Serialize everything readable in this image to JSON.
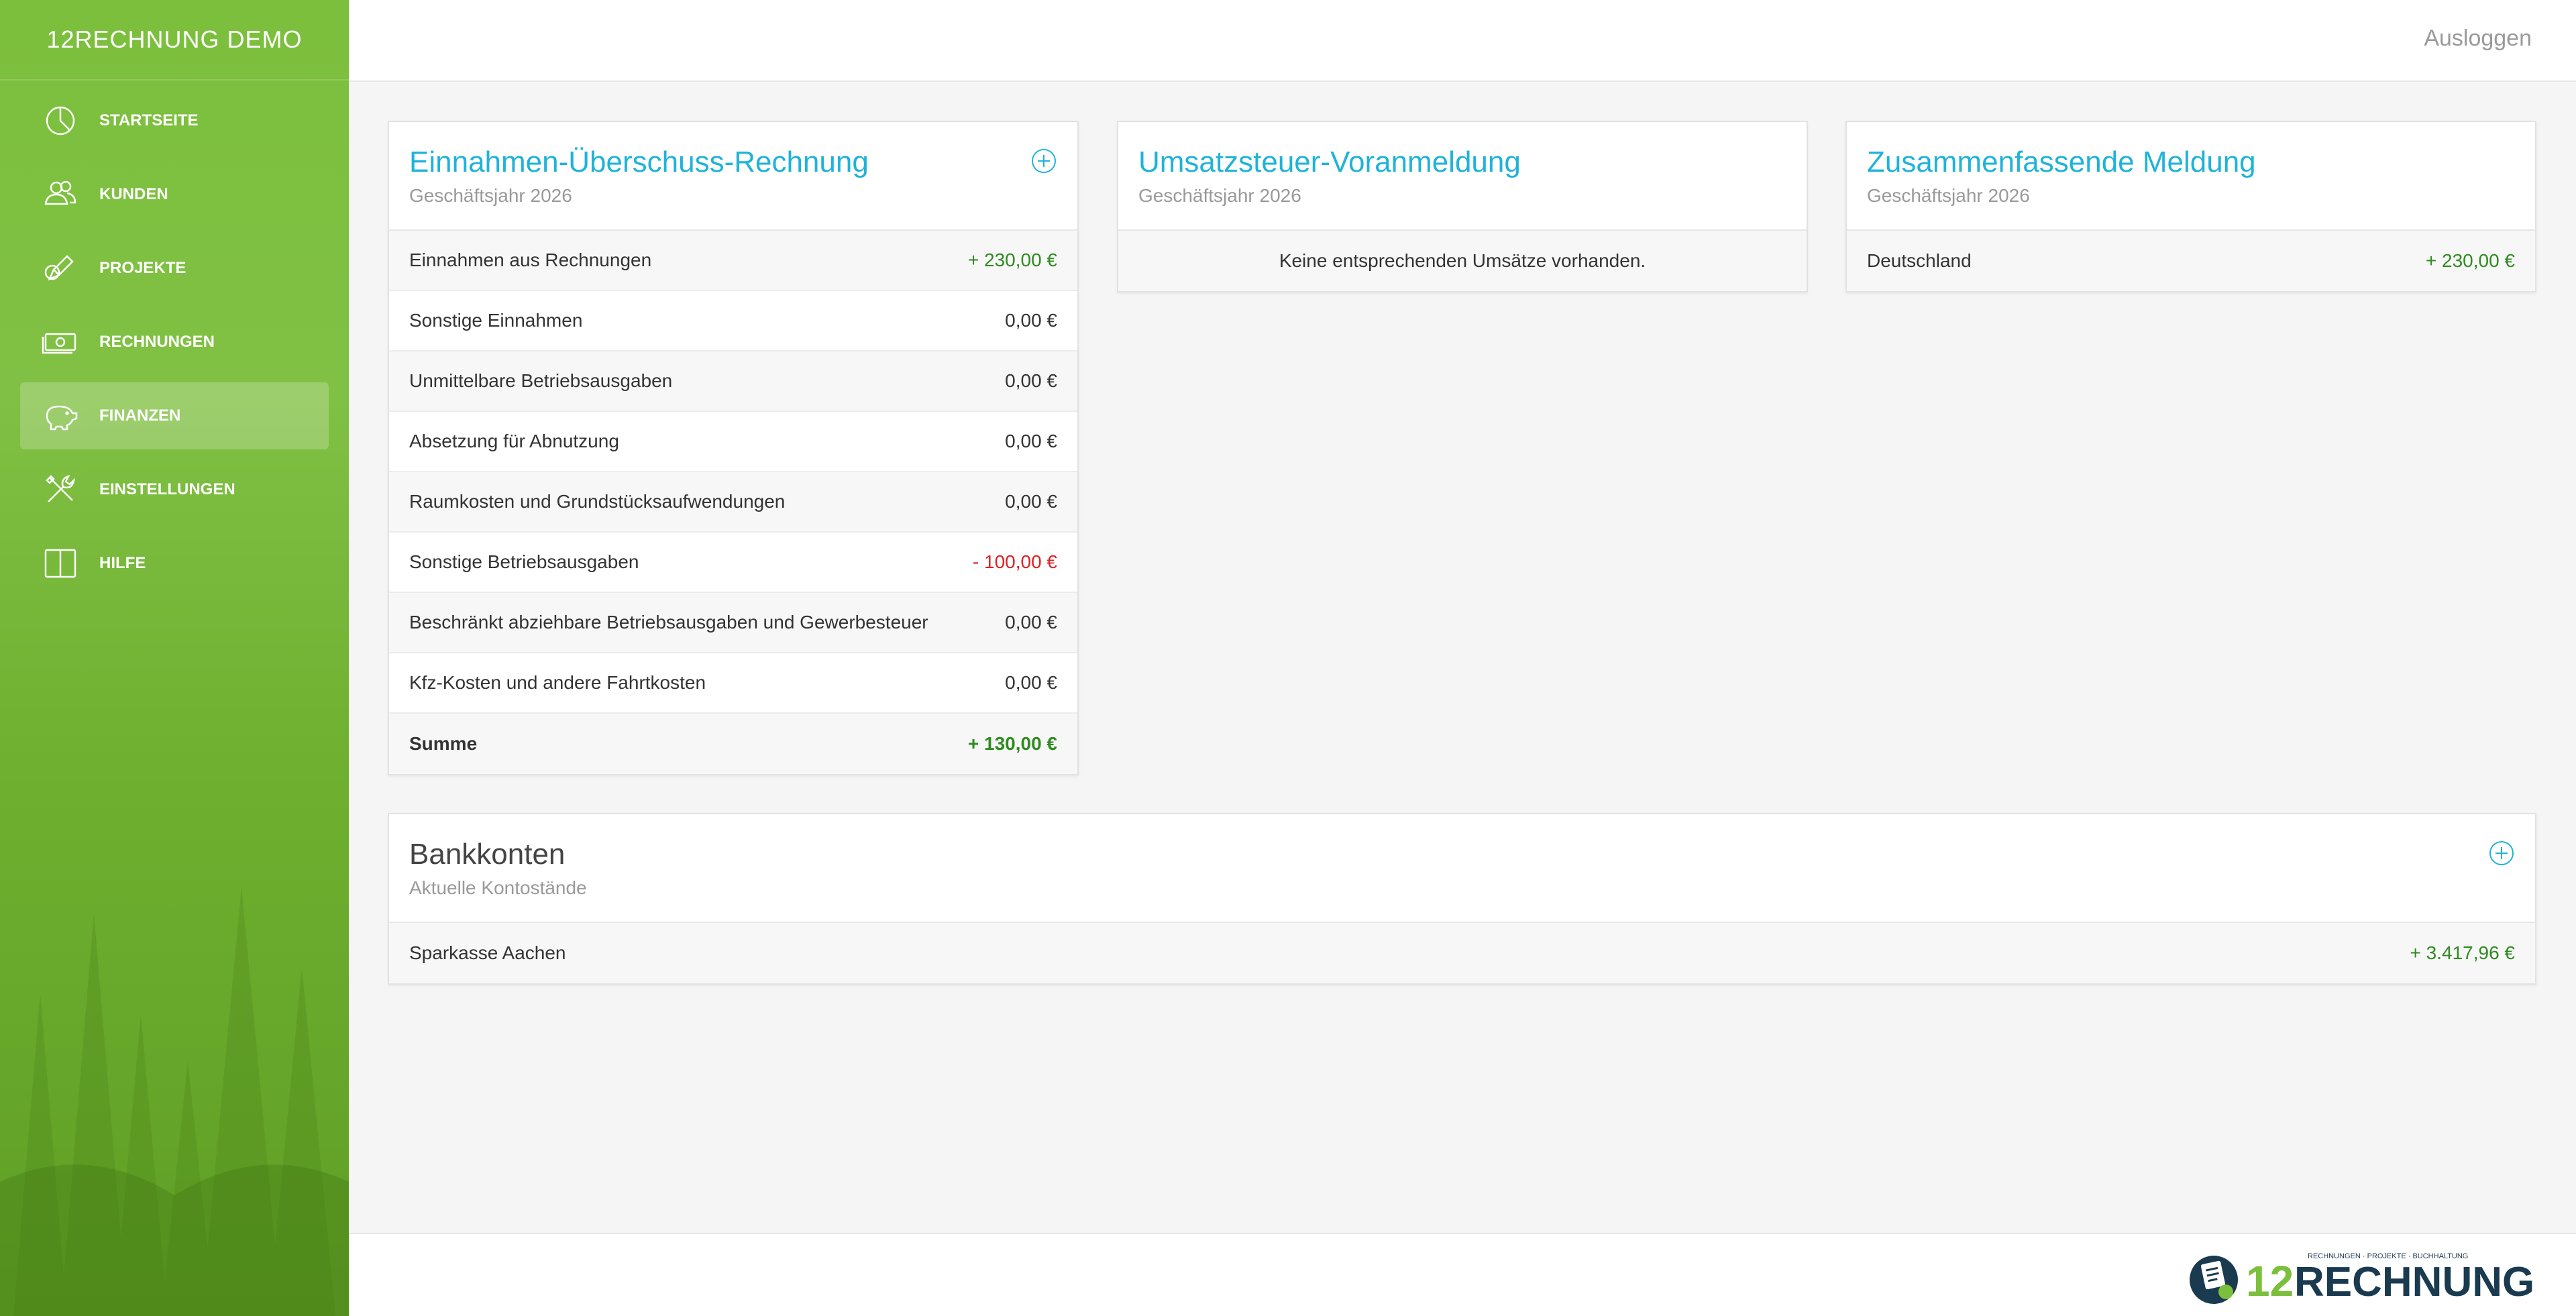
{
  "app": {
    "brand": "12RECHNUNG DEMO",
    "logout": "Ausloggen"
  },
  "sidebar": {
    "items": [
      {
        "label": "STARTSEITE",
        "icon": "pie-chart-icon"
      },
      {
        "label": "KUNDEN",
        "icon": "users-icon"
      },
      {
        "label": "PROJEKTE",
        "icon": "pencil-icon"
      },
      {
        "label": "RECHNUNGEN",
        "icon": "money-icon"
      },
      {
        "label": "FINANZEN",
        "icon": "piggy-bank-icon",
        "active": true
      },
      {
        "label": "EINSTELLUNGEN",
        "icon": "tools-icon"
      },
      {
        "label": "HILFE",
        "icon": "book-icon"
      }
    ]
  },
  "euer": {
    "title": "Einnahmen-Überschuss-Rechnung",
    "subtitle": "Geschäftsjahr 2026",
    "rows": [
      {
        "label": "Einnahmen aus Rechnungen",
        "value": "+ 230,00 €"
      },
      {
        "label": "Sonstige Einnahmen",
        "value": "0,00 €"
      },
      {
        "label": "Unmittelbare Betriebsausgaben",
        "value": "0,00 €"
      },
      {
        "label": "Absetzung für Abnutzung",
        "value": "0,00 €"
      },
      {
        "label": "Raumkosten und Grundstücksaufwendungen",
        "value": "0,00 €"
      },
      {
        "label": "Sonstige Betriebsausgaben",
        "value": "- 100,00 €"
      },
      {
        "label": "Beschränkt abziehbare Betriebsausgaben und Gewerbesteuer",
        "value": "0,00 €"
      },
      {
        "label": "Kfz-Kosten und andere Fahrtkosten",
        "value": "0,00 €"
      },
      {
        "label": "Summe",
        "value": "+ 130,00 €"
      }
    ]
  },
  "ust": {
    "title": "Umsatzsteuer-Voranmeldung",
    "subtitle": "Geschäftsjahr 2026",
    "empty": "Keine entsprechenden Umsätze vorhanden."
  },
  "zm": {
    "title": "Zusammenfassende Meldung",
    "subtitle": "Geschäftsjahr 2026",
    "rows": [
      {
        "label": "Deutschland",
        "value": "+ 230,00 €"
      }
    ]
  },
  "bank": {
    "title": "Bankkonten",
    "subtitle": "Aktuelle Kontostände",
    "rows": [
      {
        "label": "Sparkasse Aachen",
        "value": "+ 3.417,96 €"
      }
    ]
  },
  "footer": {
    "logo_number": "12",
    "logo_word": "RECHNUNG",
    "logo_tagline": "RECHNUNGEN · PROJEKTE · BUCHHALTUNG"
  },
  "colors": {
    "accent": "#1fb3d9",
    "sidebar": "#7cbf3c",
    "positive": "#2e8b1f",
    "negative": "#e02020"
  }
}
